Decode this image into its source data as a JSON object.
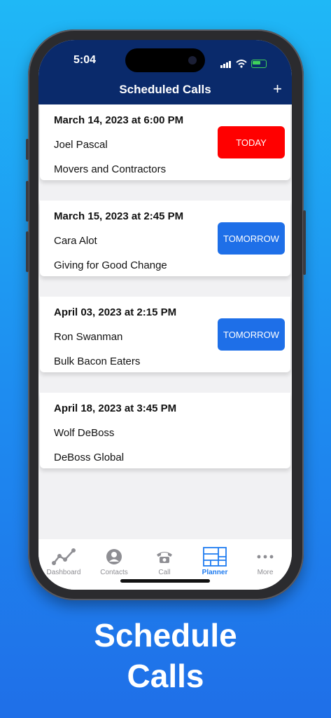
{
  "status": {
    "time": "5:04"
  },
  "nav": {
    "title": "Scheduled Calls",
    "add_label": "+"
  },
  "calls": [
    {
      "date": "March 14, 2023 at 6:00 PM",
      "name": "Joel Pascal",
      "org": "Movers and Contractors",
      "badge": "TODAY"
    },
    {
      "date": "March 15, 2023 at 2:45 PM",
      "name": "Cara Alot",
      "org": "Giving for Good Change",
      "badge": "TOMORROW"
    },
    {
      "date": "April 03, 2023 at 2:15 PM",
      "name": "Ron Swanman",
      "org": "Bulk Bacon Eaters",
      "badge": "TOMORROW"
    },
    {
      "date": "April 18, 2023 at 3:45 PM",
      "name": "Wolf DeBoss",
      "org": "DeBoss Global",
      "badge": ""
    }
  ],
  "tabs": [
    {
      "label": "Dashboard",
      "icon": "chart-line-icon"
    },
    {
      "label": "Contacts",
      "icon": "person-circle-icon"
    },
    {
      "label": "Call",
      "icon": "telephone-icon"
    },
    {
      "label": "Planner",
      "icon": "grid-planner-icon",
      "active": true
    },
    {
      "label": "More",
      "icon": "ellipsis-icon"
    }
  ],
  "colors": {
    "nav_bg": "#0a2a6b",
    "today": "#ff0000",
    "tomorrow": "#1e6fe8",
    "active_tab": "#1e7bf0"
  },
  "caption": {
    "line1": "Schedule",
    "line2": "Calls"
  }
}
